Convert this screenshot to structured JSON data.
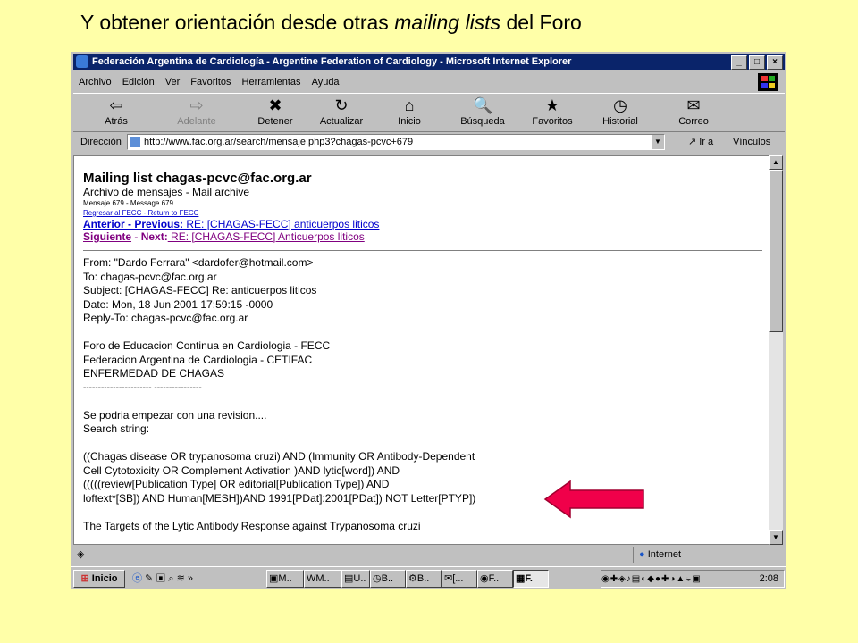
{
  "slide": {
    "title_prefix": "Y obtener orientación desde otras ",
    "title_italic": "mailing lists",
    "title_suffix": " del Foro"
  },
  "window": {
    "title": "Federación Argentina de Cardiología - Argentine Federation of Cardiology - Microsoft Internet Explorer",
    "controls": {
      "minimize": "_",
      "maximize": "□",
      "close": "×"
    }
  },
  "menu": [
    "Archivo",
    "Edición",
    "Ver",
    "Favoritos",
    "Herramientas",
    "Ayuda"
  ],
  "toolbar": [
    {
      "label": "Atrás",
      "icon": "⇦",
      "disabled": false
    },
    {
      "label": "Adelante",
      "icon": "⇨",
      "disabled": true
    },
    {
      "label": "Detener",
      "icon": "✖",
      "disabled": false
    },
    {
      "label": "Actualizar",
      "icon": "↻",
      "disabled": false
    },
    {
      "label": "Inicio",
      "icon": "⌂",
      "disabled": false
    },
    {
      "label": "Búsqueda",
      "icon": "🔍",
      "disabled": false
    },
    {
      "label": "Favoritos",
      "icon": "★",
      "disabled": false
    },
    {
      "label": "Historial",
      "icon": "◷",
      "disabled": false
    },
    {
      "label": "Correo",
      "icon": "✉",
      "disabled": false
    }
  ],
  "address": {
    "label": "Dirección",
    "url": "http://www.fac.org.ar/search/mensaje.php3?chagas-pcvc+679",
    "go": "Ir a",
    "links": "Vínculos"
  },
  "page": {
    "heading": "Mailing list chagas-pcvc@fac.org.ar",
    "archive": "Archivo de mensajes - Mail archive",
    "message": "Mensaje 679 - Message 679",
    "return_link": "Regresar al FECC - Return to FECC",
    "prev_label": "Anterior - Previous:",
    "prev_text": " RE: [CHAGAS-FECC] anticuerpos liticos",
    "next_label": "Siguiente",
    "next_sep": " - ",
    "next_label2": "Next:",
    "next_text": " RE: [CHAGAS-FECC] Anticuerpos liticos",
    "header_lines": [
      "From: \"Dardo Ferrara\" <dardofer@hotmail.com>",
      "To: chagas-pcvc@fac.org.ar",
      "Subject: [CHAGAS-FECC] Re: anticuerpos liticos",
      "Date: Mon, 18 Jun 2001 17:59:15 -0000",
      "Reply-To: chagas-pcvc@fac.org.ar"
    ],
    "org_lines": [
      "Foro de Educacion Continua en Cardiologia - FECC",
      "Federacion Argentina de Cardiologia - CETIFAC",
      "ENFERMEDAD DE CHAGAS",
      "----------------------- ----------------"
    ],
    "intro_lines": [
      "Se podria empezar con una revision....",
      "Search string:"
    ],
    "query_lines": [
      "((Chagas disease OR trypanosoma cruzi) AND (Immunity OR Antibody-Dependent",
      "Cell Cytotoxicity OR Complement Activation )AND lytic[word]) AND",
      "(((((review[Publication Type] OR editorial[Publication Type]) AND",
      "loftext*[SB]) AND Human[MESH])AND 1991[PDat]:2001[PDat]) NOT Letter[PTYP])"
    ],
    "cut_line": "The Targets of the Lytic Antibody Response against Trypanosoma cruzi"
  },
  "status": {
    "zone": "Internet"
  },
  "taskbar": {
    "start": "Inicio",
    "chevron": "»",
    "tasks": [
      "M..",
      "M..",
      "U..",
      "B..",
      "B..",
      "[...",
      "F..",
      "F."
    ],
    "clock": "2:08"
  },
  "colors": {
    "background": "#ffffa8",
    "arrow_fill": "#f0004a",
    "title_bar": "#0a246a"
  }
}
